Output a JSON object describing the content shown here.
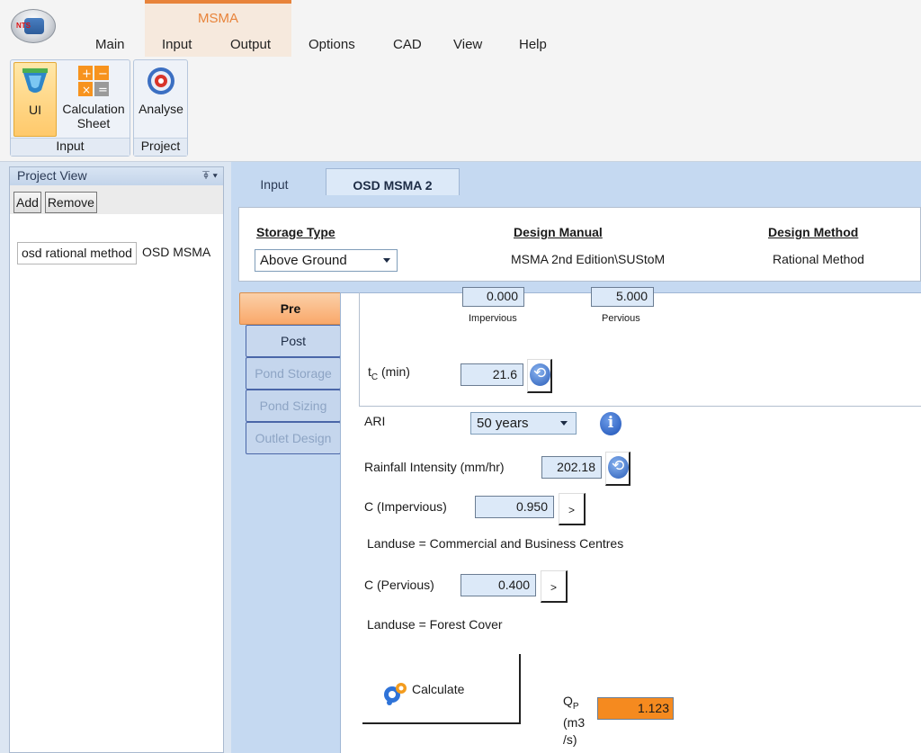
{
  "ribbon": {
    "app_logo_text": "NTS",
    "context_tab": "MSMA",
    "menu": [
      "Main",
      "Input",
      "Output",
      "Options",
      "CAD",
      "View",
      "Help"
    ],
    "buttons": {
      "ui": "UI",
      "calc_sheet": "Calculation Sheet",
      "analyse": "Analyse"
    },
    "groups": {
      "input": "Input",
      "project": "Project"
    }
  },
  "project_view": {
    "title": "Project View",
    "pin": "⍕ ▾",
    "add_label": "Add",
    "remove_label": "Remove",
    "item_name": "osd rational method",
    "item_type": "OSD MSMA"
  },
  "doc_tabs": [
    "Input",
    "OSD MSMA 2"
  ],
  "header": {
    "storage_type_title": "Storage Type",
    "storage_type_value": "Above Ground",
    "design_manual_title": "Design Manual",
    "design_manual_value": "MSMA 2nd Edition\\SUStoM",
    "design_method_title": "Design Method",
    "design_method_value": "Rational Method"
  },
  "sub_tabs": [
    "Pre",
    "Post",
    "Pond Storage",
    "Pond Sizing",
    "Outlet Design"
  ],
  "form": {
    "impervious_value": "0.000",
    "impervious_label": "Impervious",
    "pervious_value": "5.000",
    "pervious_label": "Pervious",
    "tc_label_main": "t",
    "tc_label_sub": "C",
    "tc_label_unit": " (min)",
    "tc_value": "21.6",
    "ari_label": "ARI",
    "ari_value": "50 years",
    "rainfall_label": "Rainfall Intensity (mm/hr)",
    "rainfall_value": "202.18",
    "c_imp_label": "C (Impervious)",
    "c_imp_value": "0.950",
    "gt_label": ">",
    "landuse_imp": "Landuse = Commercial and Business Centres",
    "c_perv_label": "C (Pervious)",
    "c_perv_value": "0.400",
    "landuse_perv": "Landuse = Forest Cover",
    "calculate_label": "Calculate",
    "qp_label_main": "Q",
    "qp_label_sub": "P",
    "qp_unit_1": "(m3",
    "qp_unit_2": "/s)",
    "qp_value": "1.123"
  },
  "colors": {
    "accent": "#e8833a",
    "result": "#f58a1f",
    "panel": "#c5d9f1"
  }
}
